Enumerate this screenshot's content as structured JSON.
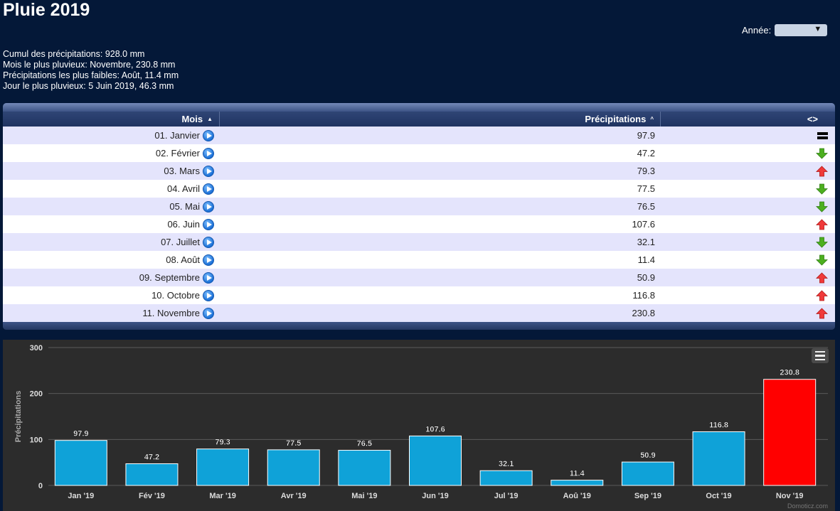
{
  "page": {
    "title": "Pluie 2019",
    "year_label": "Année:",
    "year_value": ""
  },
  "summary": [
    "Cumul des précipitations: 928.0 mm",
    "Mois le plus pluvieux: Novembre, 230.8 mm",
    "Précipitations les plus faibles: Août, 11.4 mm",
    "Jour le plus pluvieux: 5 Juin 2019, 46.3 mm"
  ],
  "table": {
    "headers": {
      "month": "Mois",
      "precipitation": "Précipitations",
      "compare": "<>"
    },
    "sort_icon": "sort-up-icon",
    "rows": [
      {
        "month": "01. Janvier",
        "value": "97.9",
        "trend": "equal"
      },
      {
        "month": "02. Février",
        "value": "47.2",
        "trend": "down"
      },
      {
        "month": "03. Mars",
        "value": "79.3",
        "trend": "up"
      },
      {
        "month": "04. Avril",
        "value": "77.5",
        "trend": "down"
      },
      {
        "month": "05. Mai",
        "value": "76.5",
        "trend": "down"
      },
      {
        "month": "06. Juin",
        "value": "107.6",
        "trend": "up"
      },
      {
        "month": "07. Juillet",
        "value": "32.1",
        "trend": "down"
      },
      {
        "month": "08. Août",
        "value": "11.4",
        "trend": "down"
      },
      {
        "month": "09. Septembre",
        "value": "50.9",
        "trend": "up"
      },
      {
        "month": "10. Octobre",
        "value": "116.8",
        "trend": "up"
      },
      {
        "month": "11. Novembre",
        "value": "230.8",
        "trend": "up"
      }
    ]
  },
  "chart_data": {
    "type": "bar",
    "categories": [
      "Jan '19",
      "Fév '19",
      "Mar '19",
      "Avr '19",
      "Mai '19",
      "Jun '19",
      "Jul '19",
      "Aoû '19",
      "Sep '19",
      "Oct '19",
      "Nov '19"
    ],
    "values": [
      97.9,
      47.2,
      79.3,
      77.5,
      76.5,
      107.6,
      32.1,
      11.4,
      50.9,
      116.8,
      230.8
    ],
    "data_labels": [
      "97.9",
      "47.2",
      "79.3",
      "77.5",
      "76.5",
      "107.6",
      "32.1",
      "11.4",
      "50.9",
      "116.8",
      "230.8"
    ],
    "title": "",
    "xlabel": "",
    "ylabel": "Précipitations",
    "ylim": [
      0,
      300
    ],
    "yticks": [
      0,
      100,
      200,
      300
    ],
    "grid": true,
    "colors": {
      "default": "#0fa2d8",
      "highlight": "#ff0000"
    },
    "highlight_index": 10
  },
  "chart_menu_icon": "hamburger-menu-icon",
  "credit": "Domoticz.com",
  "colors": {
    "background": "#041838",
    "row_odd": "#e4e4fc",
    "row_even": "#ffffff",
    "trend_up": "#f03a3a",
    "trend_down": "#4caf1f"
  }
}
